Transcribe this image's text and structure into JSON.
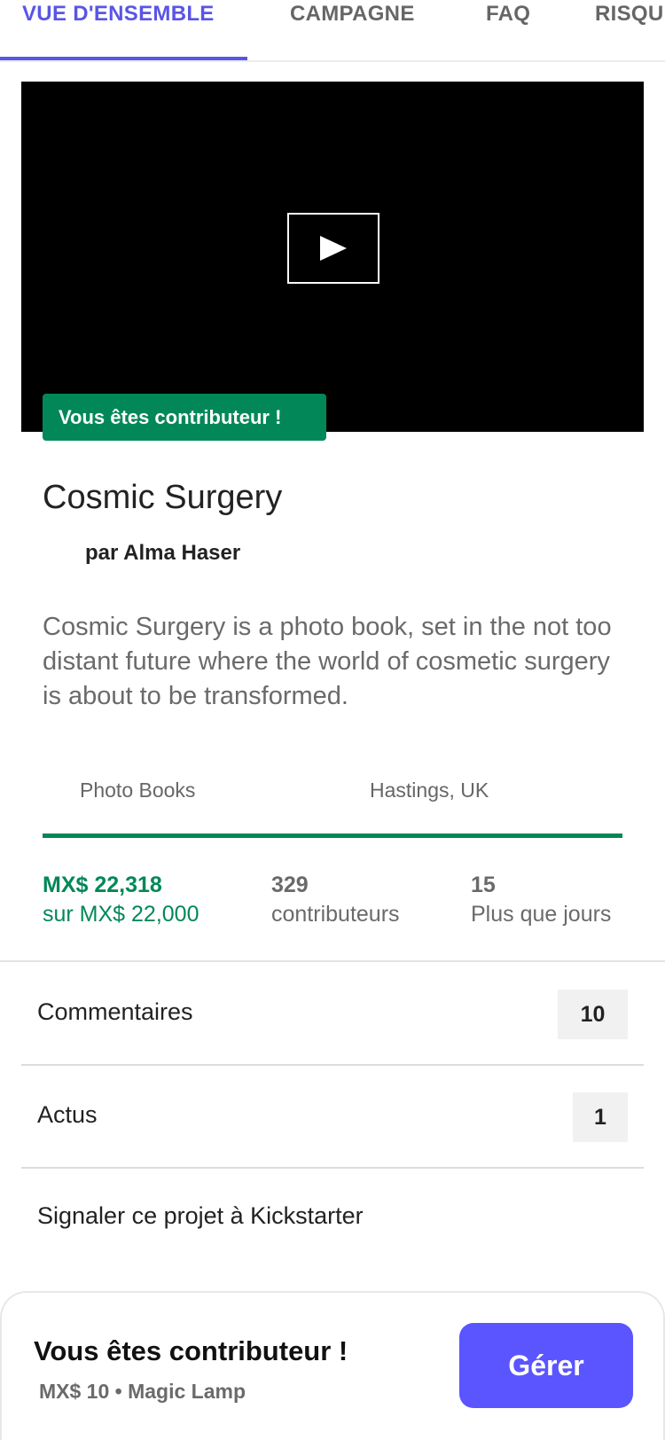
{
  "tabs": [
    {
      "label": "VUE D'ENSEMBLE",
      "active": true
    },
    {
      "label": "CAMPAGNE"
    },
    {
      "label": "FAQ"
    },
    {
      "label": "RISQUES"
    }
  ],
  "video": {
    "play_icon": "play-icon",
    "backer_badge": "Vous êtes contributeur !"
  },
  "project": {
    "title": "Cosmic Surgery",
    "creator": "par Alma Haser",
    "blurb": "Cosmic Surgery is a photo book, set in the not too distant future where the world of cosmetic surgery is about to be transformed.",
    "category": "Photo Books",
    "location": "Hastings, UK",
    "progress_fraction": 1.0
  },
  "stats": {
    "pledged": "MX$ 22,318",
    "goal": "sur MX$ 22,000",
    "backers_count": "329",
    "backers_label": "contributeurs",
    "days_count": "15",
    "days_label": "Plus que jours"
  },
  "rows": {
    "comments_label": "Commentaires",
    "comments_count": "10",
    "updates_label": "Actus",
    "updates_count": "1",
    "report_label": "Signaler ce projet à Kickstarter"
  },
  "bottom_bar": {
    "title": "Vous êtes contributeur !",
    "reward": "MX$ 10 • Magic Lamp",
    "manage_label": "Gérer"
  },
  "colors": {
    "accent": "#5a55e6",
    "green": "#028858",
    "button": "#5a55ff"
  }
}
